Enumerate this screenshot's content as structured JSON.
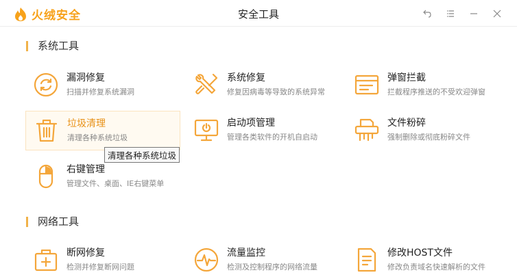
{
  "app": {
    "logo_text": "火绒安全",
    "window_title": "安全工具"
  },
  "sections": [
    {
      "title": "系统工具"
    },
    {
      "title": "网络工具"
    }
  ],
  "tools": {
    "bug_fix": {
      "name": "漏洞修复",
      "desc": "扫描并修复系统漏洞"
    },
    "sys_repair": {
      "name": "系统修复",
      "desc": "修复因病毒等导致的系统异常"
    },
    "popup_block": {
      "name": "弹窗拦截",
      "desc": "拦截程序推送的不受欢迎弹窗"
    },
    "junk_clean": {
      "name": "垃圾清理",
      "desc": "清理各种系统垃圾"
    },
    "startup_mgr": {
      "name": "启动项管理",
      "desc": "管理各类软件的开机自启动"
    },
    "file_shred": {
      "name": "文件粉碎",
      "desc": "强制删除或彻底粉碎文件"
    },
    "context_menu": {
      "name": "右键管理",
      "desc": "管理文件、桌面、IE右键菜单"
    },
    "net_repair": {
      "name": "断网修复",
      "desc": "检测并修复断网问题"
    },
    "traffic_monitor": {
      "name": "流量监控",
      "desc": "检测及控制程序的网络流量"
    },
    "host_edit": {
      "name": "修改HOST文件",
      "desc": "修改负责域名快速解析的文件"
    }
  },
  "tooltip": {
    "text": "清理各种系统垃圾"
  },
  "icons": {
    "back": "back-arrow-icon",
    "menu": "menu-icon",
    "minimize": "minimize-icon",
    "close": "close-icon"
  },
  "colors": {
    "accent": "#f4a63a",
    "logo": "#f7a21b",
    "hover_bg": "#fffaf1"
  }
}
